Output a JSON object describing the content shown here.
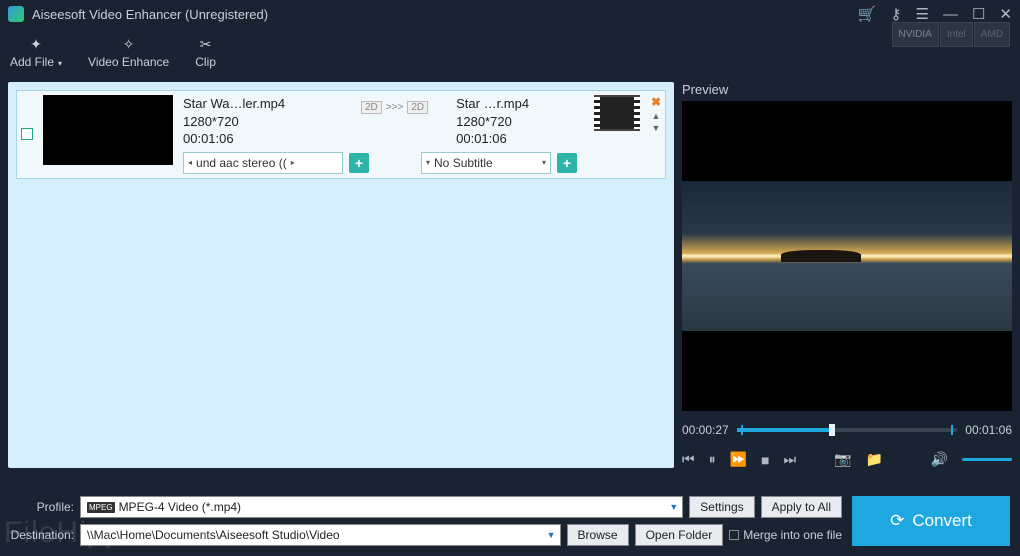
{
  "titlebar": {
    "title": "Aiseesoft Video Enhancer (Unregistered)"
  },
  "toolbar": {
    "addfile": "Add File",
    "enhance": "Video Enhance",
    "clip": "Clip"
  },
  "gpu": {
    "nvidia": "NVIDIA",
    "intel": "Intel",
    "amd": "AMD"
  },
  "item": {
    "src_name": "Star Wa…ler.mp4",
    "src_res": "1280*720",
    "src_dur": "00:01:06",
    "dst_name": "Star …r.mp4",
    "dst_res": "1280*720",
    "dst_dur": "00:01:06",
    "audio_sel": "und aac stereo ((",
    "subtitle_sel": "No Subtitle",
    "b2d": "2D",
    "b3d": "2D",
    "arr": ">>>"
  },
  "preview": {
    "title": "Preview",
    "cur": "00:00:27",
    "total": "00:01:06"
  },
  "bottom": {
    "profile_label": "Profile:",
    "profile_value": "MPEG-4 Video (*.mp4)",
    "dest_label": "Destination:",
    "dest_value": "\\\\Mac\\Home\\Documents\\Aiseesoft Studio\\Video",
    "settings": "Settings",
    "apply": "Apply to All",
    "browse": "Browse",
    "open": "Open Folder",
    "merge": "Merge into one file",
    "convert": "Convert"
  },
  "watermark": "FileHippo.com"
}
